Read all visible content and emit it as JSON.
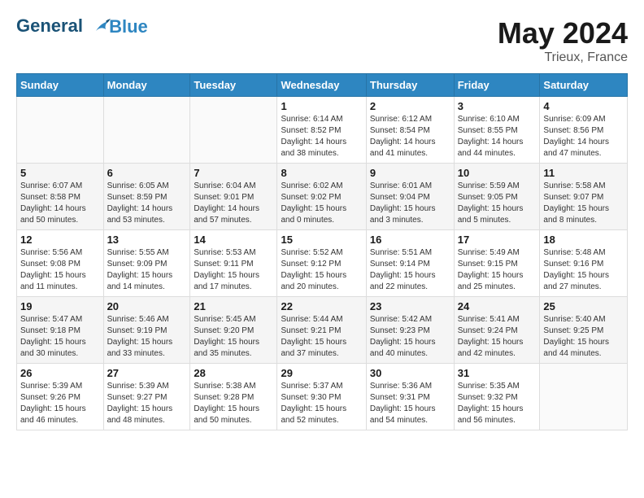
{
  "header": {
    "logo_line1": "General",
    "logo_line2": "Blue",
    "month_year": "May 2024",
    "location": "Trieux, France"
  },
  "days_of_week": [
    "Sunday",
    "Monday",
    "Tuesday",
    "Wednesday",
    "Thursday",
    "Friday",
    "Saturday"
  ],
  "weeks": [
    [
      {
        "day": "",
        "info": ""
      },
      {
        "day": "",
        "info": ""
      },
      {
        "day": "",
        "info": ""
      },
      {
        "day": "1",
        "info": "Sunrise: 6:14 AM\nSunset: 8:52 PM\nDaylight: 14 hours\nand 38 minutes."
      },
      {
        "day": "2",
        "info": "Sunrise: 6:12 AM\nSunset: 8:54 PM\nDaylight: 14 hours\nand 41 minutes."
      },
      {
        "day": "3",
        "info": "Sunrise: 6:10 AM\nSunset: 8:55 PM\nDaylight: 14 hours\nand 44 minutes."
      },
      {
        "day": "4",
        "info": "Sunrise: 6:09 AM\nSunset: 8:56 PM\nDaylight: 14 hours\nand 47 minutes."
      }
    ],
    [
      {
        "day": "5",
        "info": "Sunrise: 6:07 AM\nSunset: 8:58 PM\nDaylight: 14 hours\nand 50 minutes."
      },
      {
        "day": "6",
        "info": "Sunrise: 6:05 AM\nSunset: 8:59 PM\nDaylight: 14 hours\nand 53 minutes."
      },
      {
        "day": "7",
        "info": "Sunrise: 6:04 AM\nSunset: 9:01 PM\nDaylight: 14 hours\nand 57 minutes."
      },
      {
        "day": "8",
        "info": "Sunrise: 6:02 AM\nSunset: 9:02 PM\nDaylight: 15 hours\nand 0 minutes."
      },
      {
        "day": "9",
        "info": "Sunrise: 6:01 AM\nSunset: 9:04 PM\nDaylight: 15 hours\nand 3 minutes."
      },
      {
        "day": "10",
        "info": "Sunrise: 5:59 AM\nSunset: 9:05 PM\nDaylight: 15 hours\nand 5 minutes."
      },
      {
        "day": "11",
        "info": "Sunrise: 5:58 AM\nSunset: 9:07 PM\nDaylight: 15 hours\nand 8 minutes."
      }
    ],
    [
      {
        "day": "12",
        "info": "Sunrise: 5:56 AM\nSunset: 9:08 PM\nDaylight: 15 hours\nand 11 minutes."
      },
      {
        "day": "13",
        "info": "Sunrise: 5:55 AM\nSunset: 9:09 PM\nDaylight: 15 hours\nand 14 minutes."
      },
      {
        "day": "14",
        "info": "Sunrise: 5:53 AM\nSunset: 9:11 PM\nDaylight: 15 hours\nand 17 minutes."
      },
      {
        "day": "15",
        "info": "Sunrise: 5:52 AM\nSunset: 9:12 PM\nDaylight: 15 hours\nand 20 minutes."
      },
      {
        "day": "16",
        "info": "Sunrise: 5:51 AM\nSunset: 9:14 PM\nDaylight: 15 hours\nand 22 minutes."
      },
      {
        "day": "17",
        "info": "Sunrise: 5:49 AM\nSunset: 9:15 PM\nDaylight: 15 hours\nand 25 minutes."
      },
      {
        "day": "18",
        "info": "Sunrise: 5:48 AM\nSunset: 9:16 PM\nDaylight: 15 hours\nand 27 minutes."
      }
    ],
    [
      {
        "day": "19",
        "info": "Sunrise: 5:47 AM\nSunset: 9:18 PM\nDaylight: 15 hours\nand 30 minutes."
      },
      {
        "day": "20",
        "info": "Sunrise: 5:46 AM\nSunset: 9:19 PM\nDaylight: 15 hours\nand 33 minutes."
      },
      {
        "day": "21",
        "info": "Sunrise: 5:45 AM\nSunset: 9:20 PM\nDaylight: 15 hours\nand 35 minutes."
      },
      {
        "day": "22",
        "info": "Sunrise: 5:44 AM\nSunset: 9:21 PM\nDaylight: 15 hours\nand 37 minutes."
      },
      {
        "day": "23",
        "info": "Sunrise: 5:42 AM\nSunset: 9:23 PM\nDaylight: 15 hours\nand 40 minutes."
      },
      {
        "day": "24",
        "info": "Sunrise: 5:41 AM\nSunset: 9:24 PM\nDaylight: 15 hours\nand 42 minutes."
      },
      {
        "day": "25",
        "info": "Sunrise: 5:40 AM\nSunset: 9:25 PM\nDaylight: 15 hours\nand 44 minutes."
      }
    ],
    [
      {
        "day": "26",
        "info": "Sunrise: 5:39 AM\nSunset: 9:26 PM\nDaylight: 15 hours\nand 46 minutes."
      },
      {
        "day": "27",
        "info": "Sunrise: 5:39 AM\nSunset: 9:27 PM\nDaylight: 15 hours\nand 48 minutes."
      },
      {
        "day": "28",
        "info": "Sunrise: 5:38 AM\nSunset: 9:28 PM\nDaylight: 15 hours\nand 50 minutes."
      },
      {
        "day": "29",
        "info": "Sunrise: 5:37 AM\nSunset: 9:30 PM\nDaylight: 15 hours\nand 52 minutes."
      },
      {
        "day": "30",
        "info": "Sunrise: 5:36 AM\nSunset: 9:31 PM\nDaylight: 15 hours\nand 54 minutes."
      },
      {
        "day": "31",
        "info": "Sunrise: 5:35 AM\nSunset: 9:32 PM\nDaylight: 15 hours\nand 56 minutes."
      },
      {
        "day": "",
        "info": ""
      }
    ]
  ]
}
